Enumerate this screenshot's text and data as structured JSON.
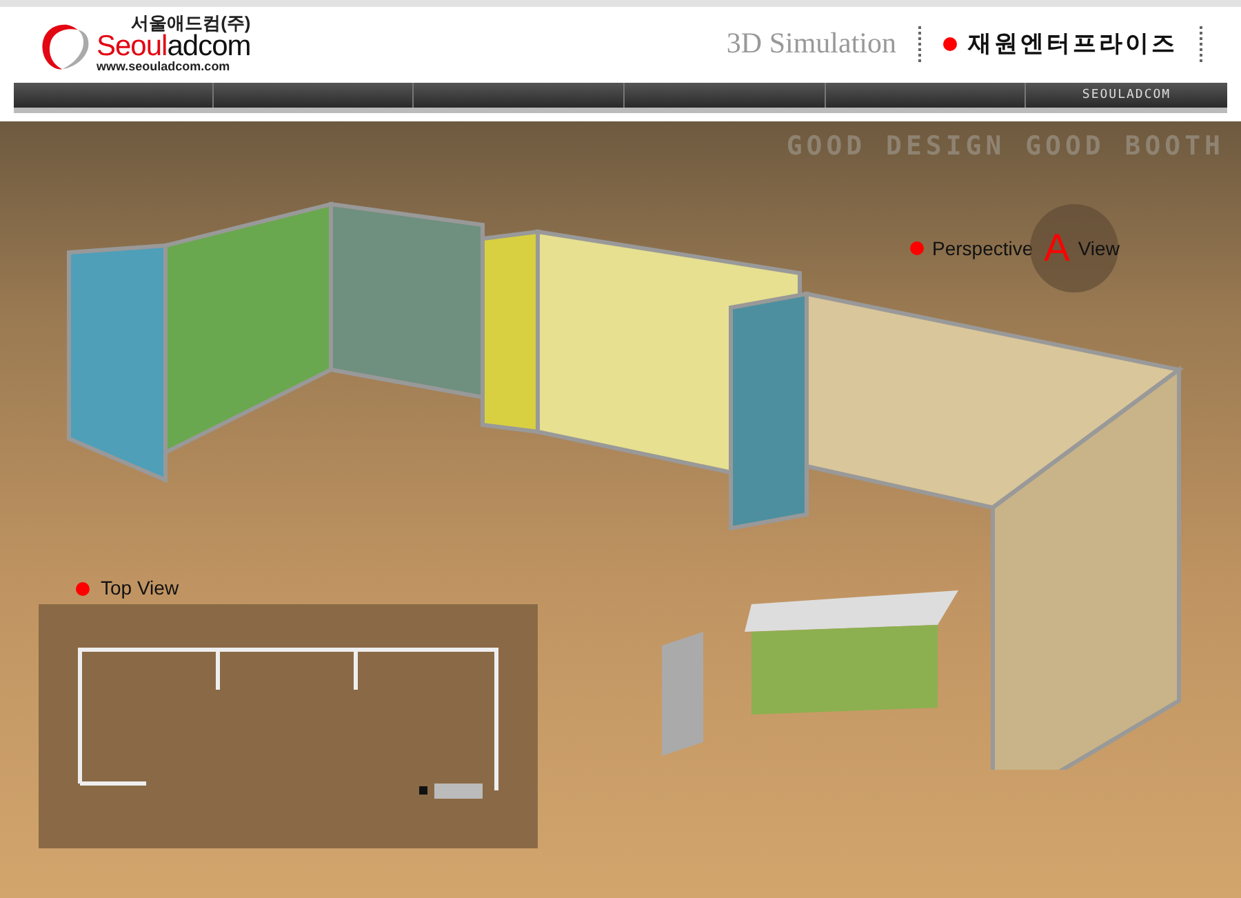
{
  "logo": {
    "korean_name": "서울애드컴(주)",
    "wordmark_red": "Seoul",
    "wordmark_dark": "adcom",
    "url": "www.seouladcom.com"
  },
  "header": {
    "title": "3D Simulation",
    "client": "재원엔터프라이즈"
  },
  "nav": {
    "label": "SEOULADCOM"
  },
  "scene": {
    "slogan": "GOOD DESIGN GOOD BOOTH",
    "perspective": {
      "prefix": "Perspective",
      "letter": "A",
      "suffix": "View"
    },
    "top_view": {
      "label": "Top View"
    }
  }
}
